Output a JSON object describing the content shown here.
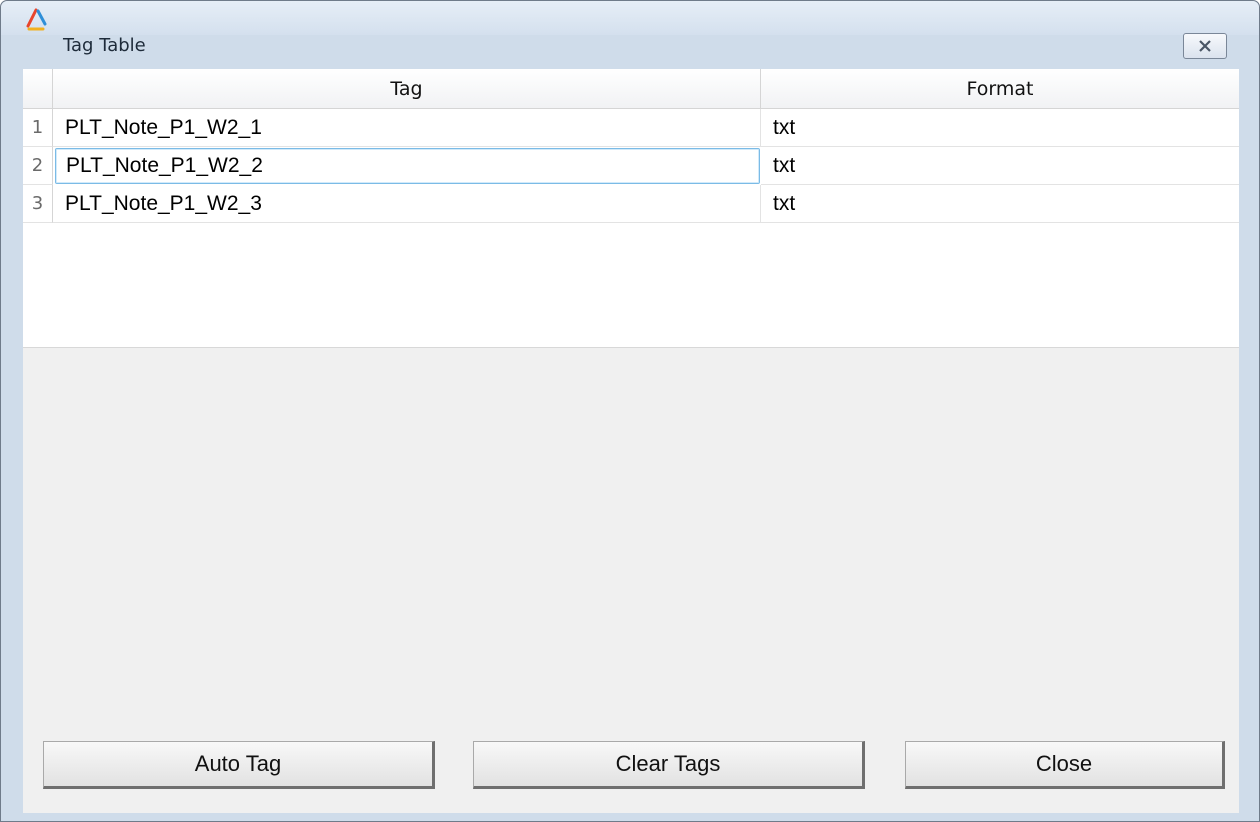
{
  "window": {
    "title": "Tag Table"
  },
  "table": {
    "columns": [
      "Tag",
      "Format"
    ],
    "rows": [
      {
        "num": "1",
        "tag": "PLT_Note_P1_W2_1",
        "format": "txt"
      },
      {
        "num": "2",
        "tag": "PLT_Note_P1_W2_2",
        "format": "txt"
      },
      {
        "num": "3",
        "tag": "PLT_Note_P1_W2_3",
        "format": "txt"
      }
    ],
    "selected_row": 2
  },
  "buttons": {
    "auto_tag": "Auto Tag",
    "clear_tags": "Clear Tags",
    "close": "Close"
  },
  "icons": {
    "app": "app-logo-icon",
    "close": "close-icon"
  },
  "colors": {
    "selection_border": "#7bbbe6",
    "titlebar": "#d4e0ee",
    "client_bg": "#f0f0f0"
  }
}
